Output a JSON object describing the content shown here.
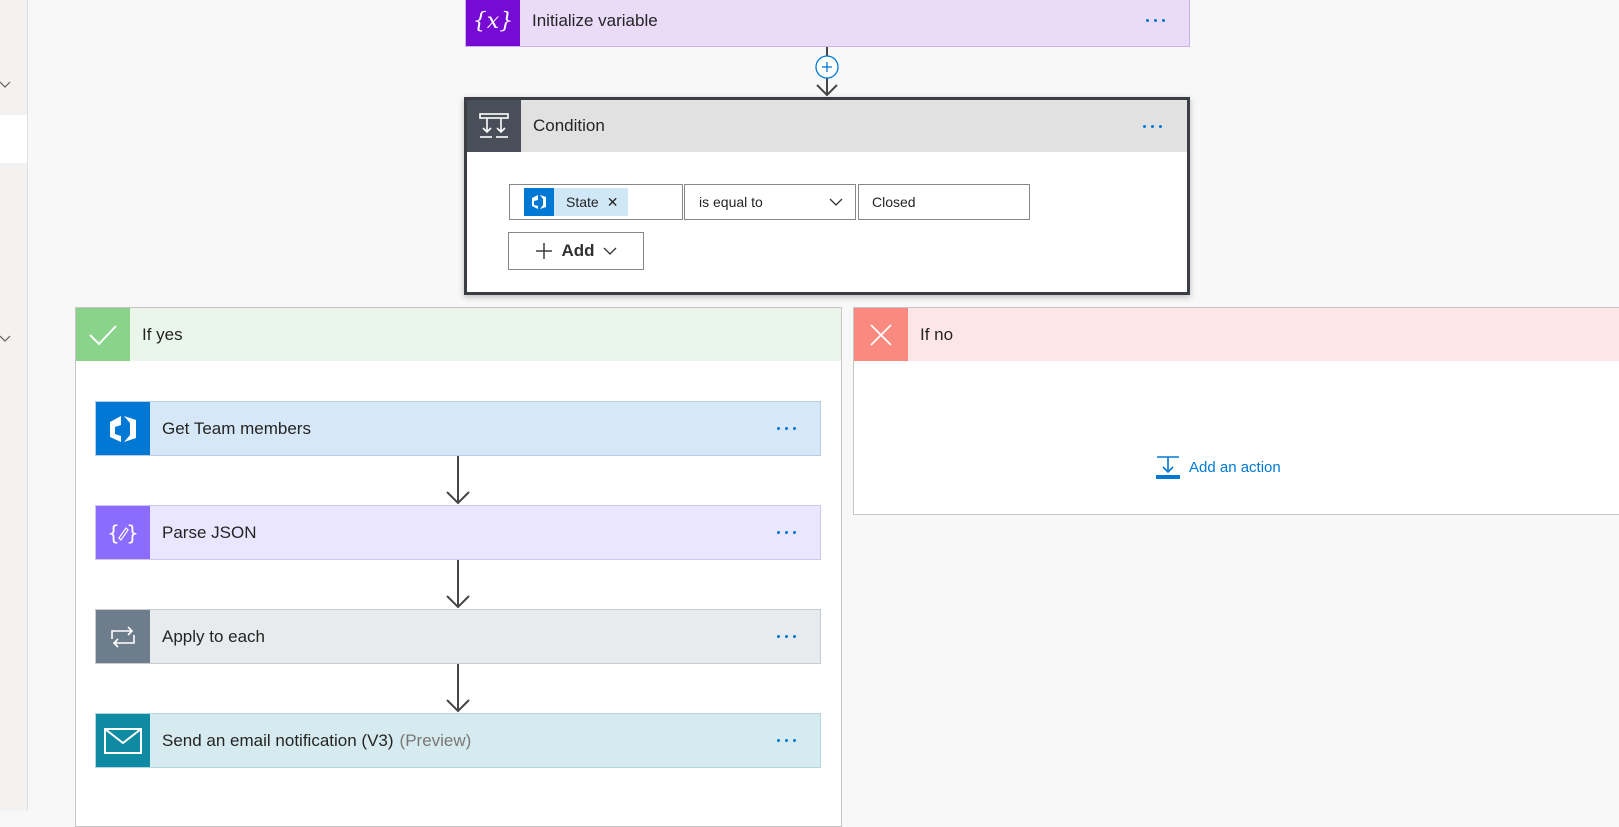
{
  "colors": {
    "variable_purple": "#770bd6",
    "variable_header": "#eadbf9",
    "condition_dark": "#484f58",
    "condition_header": "#e1e1e1",
    "yes_green": "#8ad38a",
    "yes_header": "#eaf6ea",
    "no_red": "#fa8a80",
    "no_header": "#ffe6e6",
    "devops_blue": "#0078d4",
    "devops_header": "#d6e8f7",
    "parse_purple": "#8c6cff",
    "parse_header": "#ebe6ff",
    "apply_gray": "#6e7d8c",
    "apply_header": "#e8ebee",
    "mail_teal": "#0f8aa3",
    "mail_header": "#d6ebf0",
    "link_blue": "#0078d4"
  },
  "init_variable": {
    "title": "Initialize variable",
    "icon": "curly-x-icon"
  },
  "condition": {
    "title": "Condition",
    "icon": "condition-icon",
    "token_label": "State",
    "token_icon": "azure-devops-icon",
    "operator": "is equal to",
    "value": "Closed",
    "add_label": "Add"
  },
  "branch_yes": {
    "title": "If yes",
    "actions": [
      {
        "title": "Get Team members",
        "suffix": "",
        "icon": "azure-devops-icon"
      },
      {
        "title": "Parse JSON",
        "suffix": "",
        "icon": "parse-json-icon"
      },
      {
        "title": "Apply to each",
        "suffix": "",
        "icon": "loop-icon"
      },
      {
        "title": "Send an email notification (V3)",
        "suffix": "(Preview)",
        "icon": "mail-icon"
      }
    ]
  },
  "branch_no": {
    "title": "If no",
    "add_action_label": "Add an action"
  }
}
